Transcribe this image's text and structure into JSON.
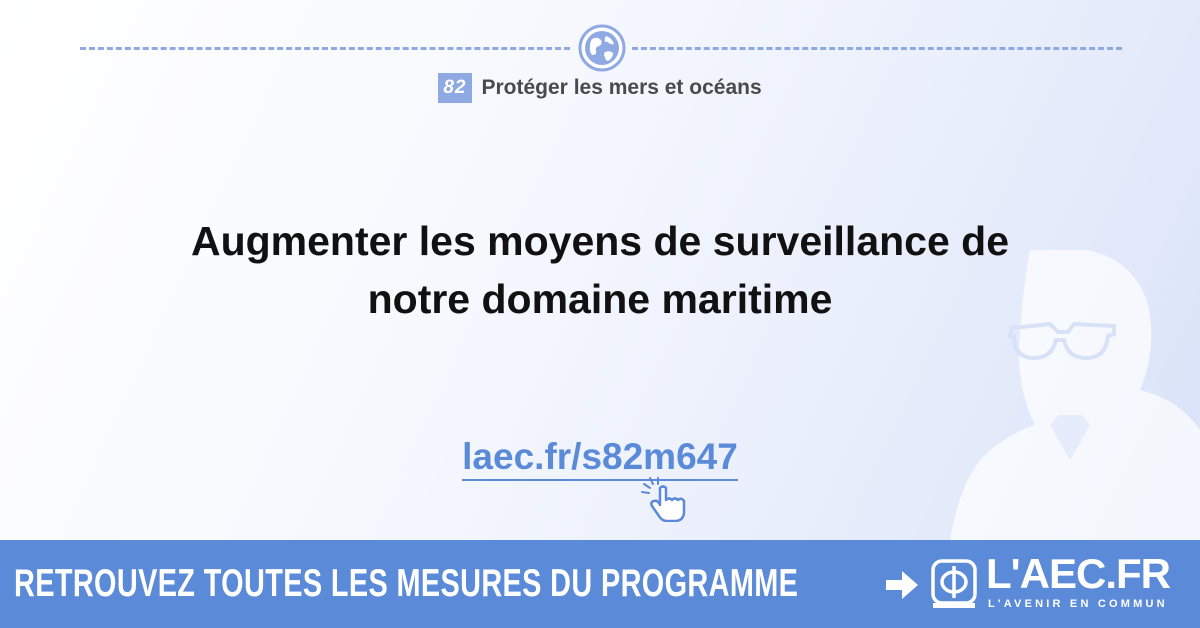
{
  "header": {
    "measure_number": "82",
    "category": "Protéger les mers et océans"
  },
  "main": {
    "headline_line1": "Augmenter les moyens de surveillance de",
    "headline_line2": "notre domaine maritime",
    "short_link": "laec.fr/s82m647"
  },
  "banner": {
    "cta": "RETROUVEZ TOUTES LES MESURES DU PROGRAMME",
    "logo_text": "L'AEC.FR",
    "logo_tagline": "L'AVENIR EN COMMUN"
  },
  "icons": {
    "globe": "globe-icon",
    "pointer": "hand-pointer-icon",
    "arrow": "arrow-right-icon",
    "logo": "phi-logo-icon"
  },
  "colors": {
    "accent": "#5b8ad8",
    "accent_light": "#8fa9e3",
    "text_dark": "#111111",
    "text_muted": "#4a4a4a",
    "banner_text": "#ffffff"
  }
}
